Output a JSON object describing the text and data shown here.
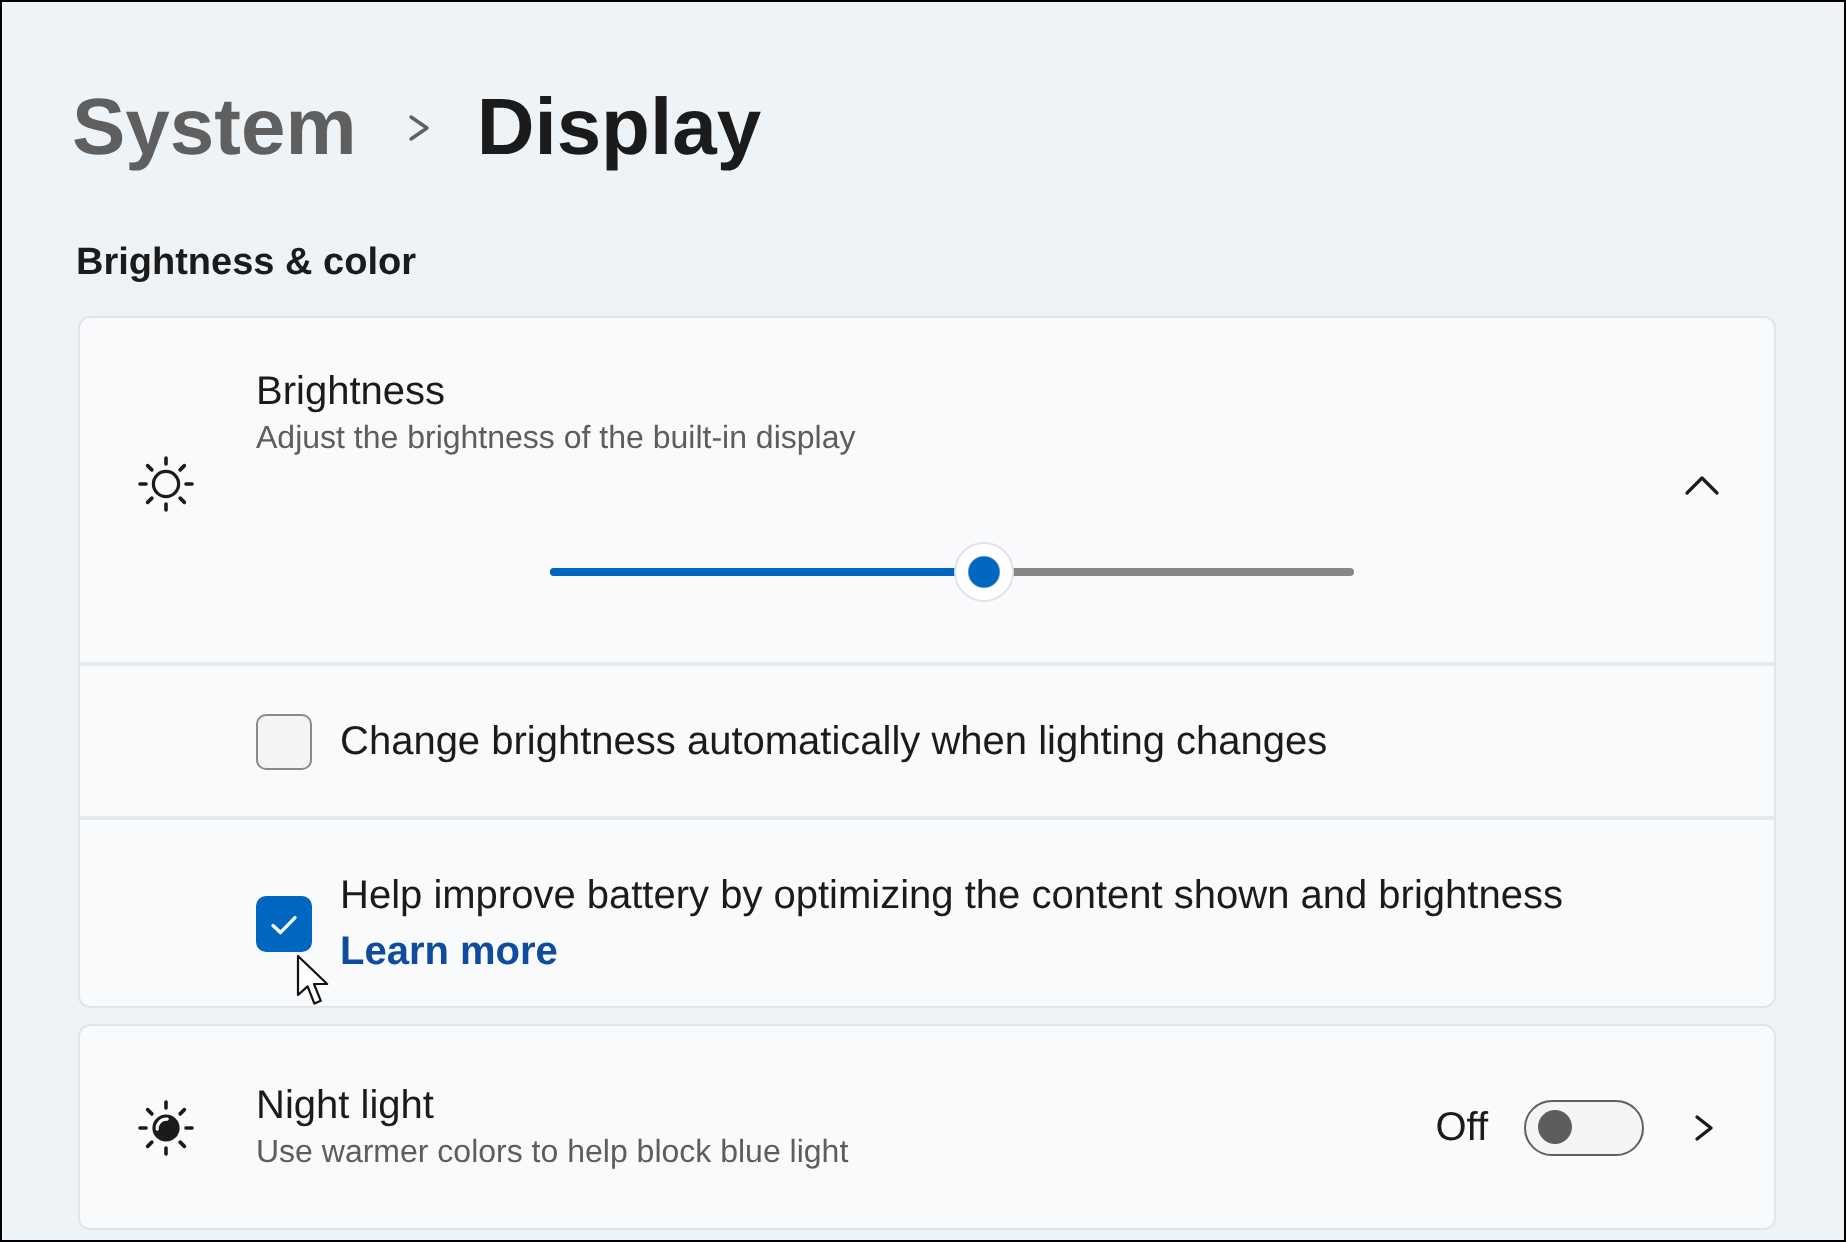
{
  "breadcrumb": {
    "parent": "System",
    "current": "Display"
  },
  "section_title": "Brightness & color",
  "brightness": {
    "title": "Brightness",
    "description": "Adjust the brightness of the built-in display",
    "expanded": true,
    "level": 0.54,
    "options": [
      {
        "label": "Change brightness automatically when lighting changes",
        "checked": false
      },
      {
        "label": "Help improve battery by optimizing the content shown and brightness",
        "checked": true,
        "link": "Learn more"
      }
    ]
  },
  "night_light": {
    "title": "Night light",
    "description": "Use warmer colors to help block blue light",
    "state_label": "Off",
    "on": false
  }
}
